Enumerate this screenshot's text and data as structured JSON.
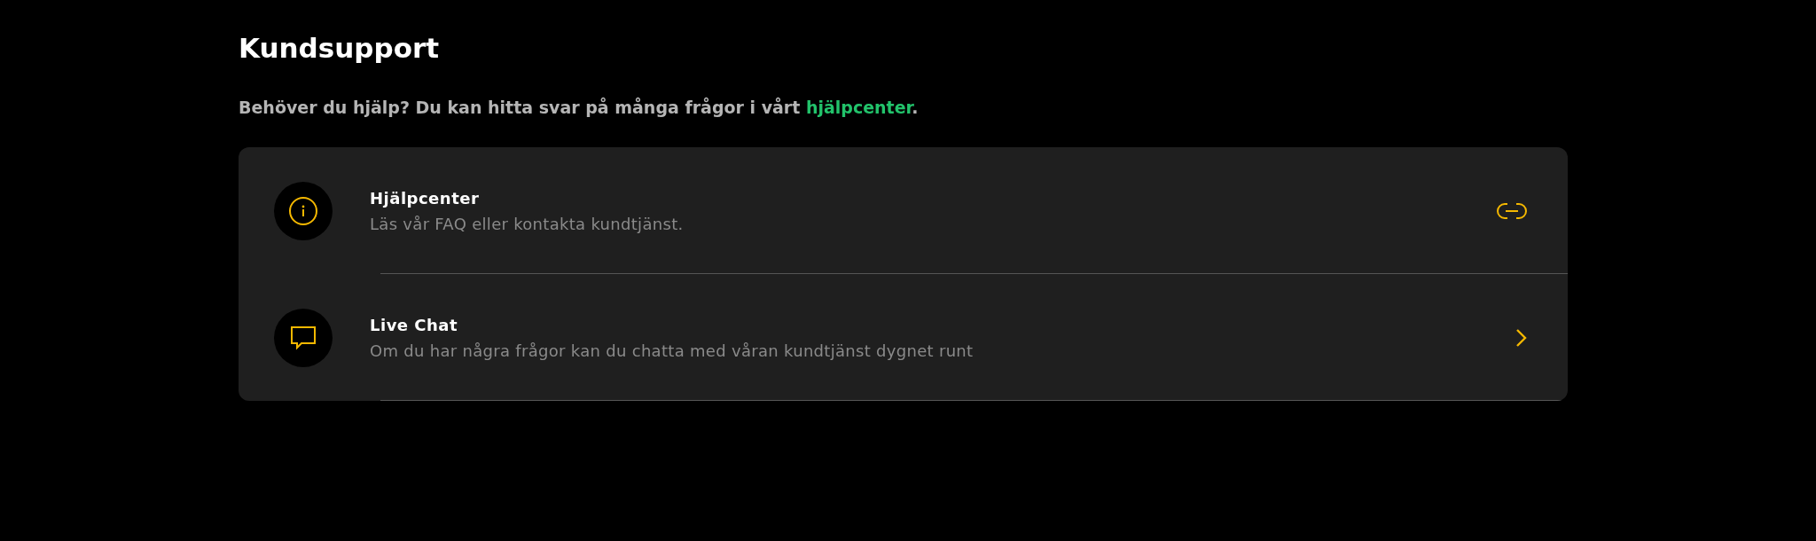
{
  "title": "Kundsupport",
  "intro": {
    "text": "Behöver du hjälp? Du kan hitta svar på många frågor i vårt ",
    "link": "hjälpcenter",
    "after": "."
  },
  "items": [
    {
      "kind": "help",
      "title": "Hjälpcenter",
      "description": "Läs vår FAQ eller kontakta kundtjänst."
    },
    {
      "kind": "chat",
      "title": "Live Chat",
      "description": "Om du har några frågor kan du chatta med våran kundtjänst dygnet runt"
    }
  ]
}
